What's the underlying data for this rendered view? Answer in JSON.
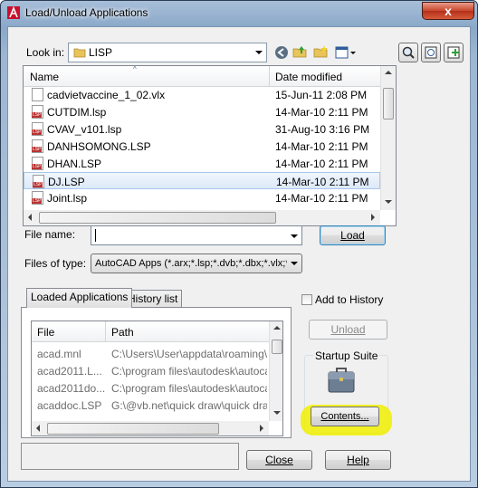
{
  "window": {
    "title": "Load/Unload Applications",
    "close_glyph": "x"
  },
  "look_in": {
    "label": "Look in:",
    "folder": "LISP"
  },
  "file_list": {
    "col_name": "Name",
    "col_date": "Date modified",
    "rows": [
      {
        "name": "cadvietvaccine_1_02.vlx",
        "date": "15-Jun-11 2:08 PM",
        "type": "vlx"
      },
      {
        "name": "CUTDIM.lsp",
        "date": "14-Mar-10 2:11 PM",
        "type": "lsp"
      },
      {
        "name": "CVAV_v101.lsp",
        "date": "31-Aug-10 3:16 PM",
        "type": "lsp"
      },
      {
        "name": "DANHSOMONG.LSP",
        "date": "14-Mar-10 2:11 PM",
        "type": "lsp"
      },
      {
        "name": "DHAN.LSP",
        "date": "14-Mar-10 2:11 PM",
        "type": "lsp"
      },
      {
        "name": "DJ.LSP",
        "date": "14-Mar-10 2:11 PM",
        "type": "lsp"
      },
      {
        "name": "Joint.lsp",
        "date": "14-Mar-10 2:11 PM",
        "type": "lsp"
      }
    ],
    "selected_index": 5
  },
  "file_name": {
    "label": "File name:",
    "value": ""
  },
  "files_of_type": {
    "label": "Files of type:",
    "value": "AutoCAD Apps (*.arx;*.lsp;*.dvb;*.dbx;*.vlx;*."
  },
  "buttons": {
    "load": "Load",
    "unload": "Unload",
    "contents": "Contents...",
    "close": "Close",
    "help": "Help"
  },
  "tabs": {
    "loaded": "Loaded Applications",
    "history": "History list"
  },
  "loaded_apps": {
    "col_file": "File",
    "col_path": "Path",
    "rows": [
      {
        "file": "acad.mnl",
        "path": "C:\\Users\\User\\appdata\\roaming\\a..."
      },
      {
        "file": "acad2011.L...",
        "path": "C:\\program files\\autodesk\\autocad ..."
      },
      {
        "file": "acad2011do...",
        "path": "C:\\program files\\autodesk\\autocad ..."
      },
      {
        "file": "acaddoc.LSP",
        "path": "G:\\@vb.net\\quick draw\\quick draw"
      },
      {
        "file": "",
        "path": ""
      }
    ]
  },
  "add_to_history": {
    "label": "Add to History",
    "checked": false
  },
  "startup_suite": {
    "label": "Startup Suite"
  },
  "colors": {
    "highlight": "#f0f000",
    "title_bar": "#8aa8c9",
    "close_red": "#c9452b"
  }
}
